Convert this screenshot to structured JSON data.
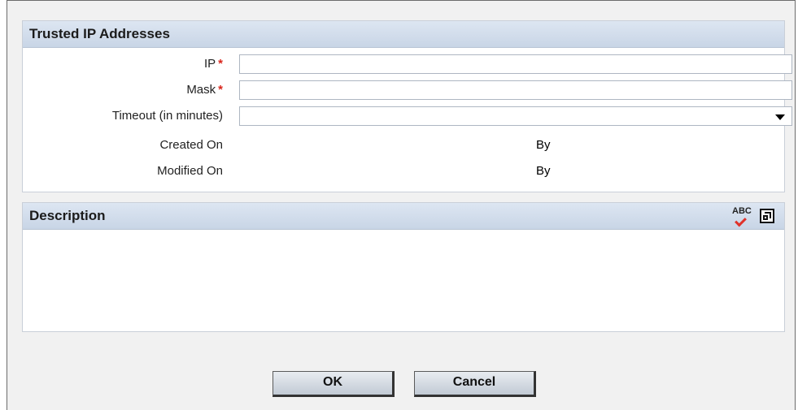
{
  "trusted_section": {
    "title": "Trusted IP Addresses",
    "fields": {
      "ip": {
        "label": "IP",
        "value": ""
      },
      "mask": {
        "label": "Mask",
        "value": ""
      },
      "timeout": {
        "label": "Timeout (in minutes)",
        "value": ""
      },
      "created_on": {
        "label": "Created On",
        "by_label": "By"
      },
      "modified_on": {
        "label": "Modified On",
        "by_label": "By"
      }
    },
    "required_marker": "*"
  },
  "description_section": {
    "title": "Description",
    "spellcheck_icon": "spellcheck-icon",
    "spellcheck_text": "ABC",
    "expand_icon": "expand-icon",
    "value": ""
  },
  "buttons": {
    "ok": "OK",
    "cancel": "Cancel"
  },
  "colors": {
    "header_bg": "#c8d5e6",
    "required": "#d9261c"
  }
}
